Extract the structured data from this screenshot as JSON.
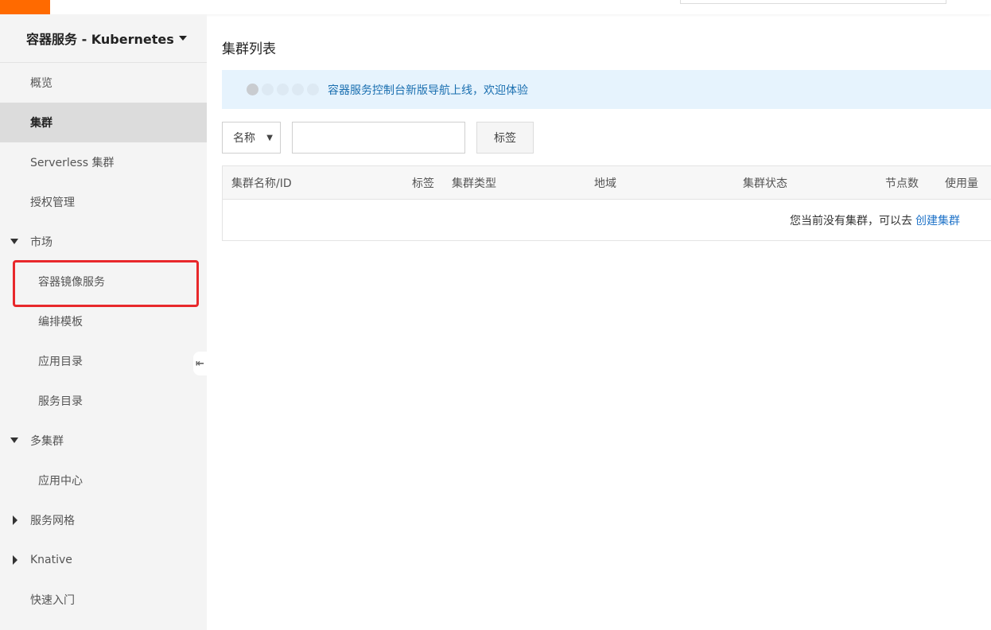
{
  "colors": {
    "brand": "#ff6a00",
    "active_bg": "#dcdcdc",
    "notice_bg": "#e6f3fd",
    "link": "#1f73c8",
    "highlight": "#e8282b"
  },
  "sidebar": {
    "title": "容器服务 - Kubernetes",
    "items": [
      {
        "label": "概览"
      },
      {
        "label": "集群"
      },
      {
        "label": "Serverless 集群"
      },
      {
        "label": "授权管理"
      },
      {
        "label": "市场"
      },
      {
        "label": "容器镜像服务"
      },
      {
        "label": "编排模板"
      },
      {
        "label": "应用目录"
      },
      {
        "label": "服务目录"
      },
      {
        "label": "多集群"
      },
      {
        "label": "应用中心"
      },
      {
        "label": "服务网格"
      },
      {
        "label": "Knative"
      },
      {
        "label": "快速入门"
      }
    ],
    "collapse_icon": "collapse-left-icon"
  },
  "main": {
    "page_title": "集群列表",
    "notice": {
      "text": "容器服务控制台新版导航上线，欢迎体验"
    },
    "filter": {
      "select_value": "名称",
      "input_value": "",
      "tag_label": "标签"
    },
    "table": {
      "columns": [
        "集群名称/ID",
        "标签",
        "集群类型",
        "地域",
        "集群状态",
        "节点数",
        "使用量"
      ],
      "empty_text": "您当前没有集群，可以去",
      "empty_link": "创建集群"
    }
  }
}
